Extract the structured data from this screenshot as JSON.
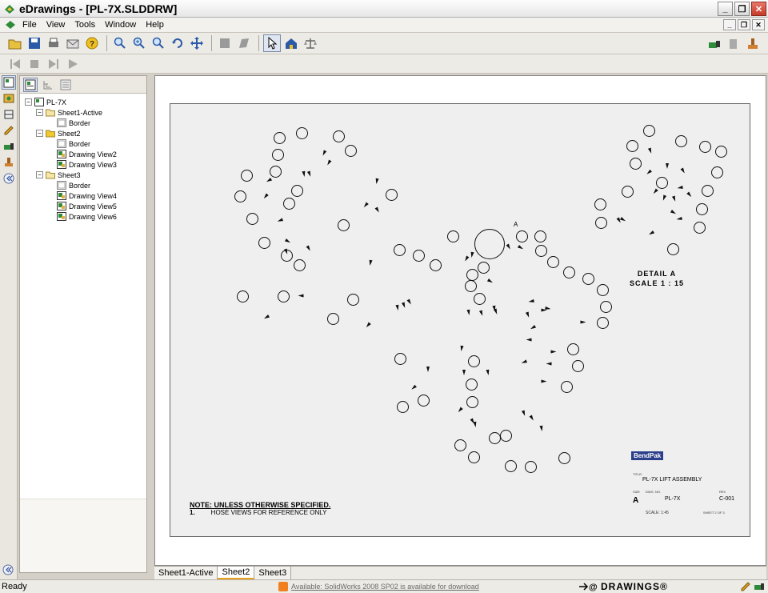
{
  "window": {
    "title": "eDrawings - [PL-7X.SLDDRW]"
  },
  "menu": {
    "items": [
      "File",
      "View",
      "Tools",
      "Window",
      "Help"
    ]
  },
  "tree": {
    "root": "PL-7X",
    "nodes": [
      {
        "label": "Sheet1-Active"
      },
      {
        "label": "Border"
      },
      {
        "label": "Sheet2"
      },
      {
        "label": "Border"
      },
      {
        "label": "Drawing View2"
      },
      {
        "label": "Drawing View3"
      },
      {
        "label": "Sheet3"
      },
      {
        "label": "Border"
      },
      {
        "label": "Drawing View4"
      },
      {
        "label": "Drawing View5"
      },
      {
        "label": "Drawing View6"
      }
    ]
  },
  "drawing": {
    "detail_letter": "A",
    "detail_label": "DETAIL A",
    "detail_scale": "SCALE 1 : 15",
    "note_title": "NOTE: UNLESS OTHERWISE SPECIFIED.",
    "note_num": "1.",
    "note_text": "HOSE VIEWS FOR REFERENCE ONLY",
    "titleblock": {
      "logo": "BendPak",
      "title_label": "TITLE:",
      "title": "PL-7X LIFT ASSEMBLY",
      "size_label": "SIZE",
      "dwg_label": "DWG. NO.",
      "rev_label": "REV",
      "size": "A",
      "dwg_no": "PL-7X",
      "rev": "C-001",
      "scale": "SCALE: 1:45",
      "sheet": "SHEET 2 OF 3"
    }
  },
  "sheet_tabs": [
    "Sheet1-Active",
    "Sheet2",
    "Sheet3"
  ],
  "active_tab": "Sheet2",
  "status": {
    "text": "Ready",
    "notice": "Available: SolidWorks 2008 SP02 is available for download",
    "brand": "DRAWINGS®"
  }
}
